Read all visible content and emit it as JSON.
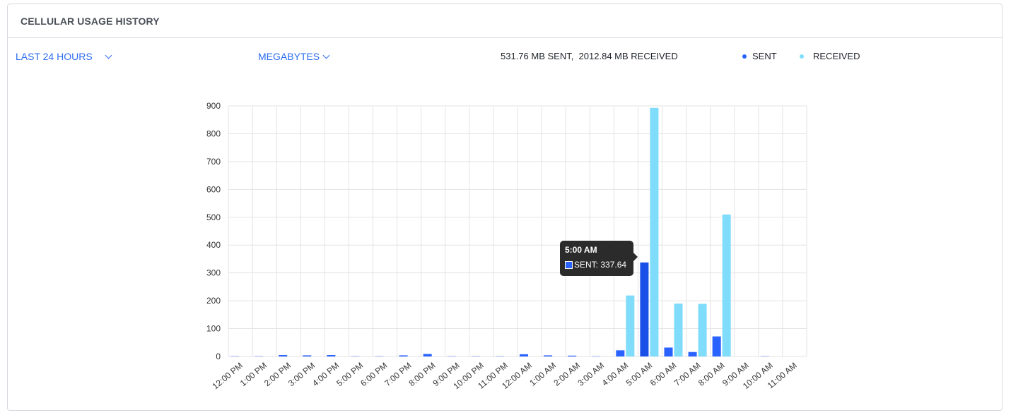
{
  "card": {
    "title": "CELLULAR USAGE HISTORY"
  },
  "controls": {
    "range_label": "LAST 24 HOURS",
    "unit_label": "MEGABYTES",
    "totals_text": "531.76 MB SENT,  2012.84 MB RECEIVED"
  },
  "colors": {
    "sent": "#2962ff",
    "received": "#80dcfb",
    "accent": "#2c6cf0"
  },
  "chart_data": {
    "type": "bar",
    "categories": [
      "12:00 PM",
      "1:00 PM",
      "2:00 PM",
      "3:00 PM",
      "4:00 PM",
      "5:00 PM",
      "6:00 PM",
      "7:00 PM",
      "8:00 PM",
      "9:00 PM",
      "10:00 PM",
      "11:00 PM",
      "12:00 AM",
      "1:00 AM",
      "2:00 AM",
      "3:00 AM",
      "4:00 AM",
      "5:00 AM",
      "6:00 AM",
      "7:00 AM",
      "8:00 AM",
      "9:00 AM",
      "10:00 AM",
      "11:00 AM"
    ],
    "series": [
      {
        "name": "SENT",
        "values": [
          1,
          1,
          5,
          4,
          5,
          1,
          1,
          4,
          9,
          1,
          1,
          1,
          8,
          4,
          3,
          1,
          22,
          337.64,
          32,
          16,
          72,
          0,
          1,
          0
        ]
      },
      {
        "name": "RECEIVED",
        "values": [
          0,
          0,
          0,
          0,
          0,
          0,
          0,
          0,
          0,
          0,
          0,
          0,
          0,
          0,
          0,
          0,
          219,
          893,
          190,
          189,
          510,
          0,
          0,
          0
        ]
      }
    ],
    "yticks": [
      0,
      100,
      200,
      300,
      400,
      500,
      600,
      700,
      800,
      900
    ],
    "ylim": [
      0,
      900
    ],
    "grid": true,
    "legend": "top-right",
    "tooltip": {
      "title": "5:00 AM",
      "text": "SENT: 337.64"
    }
  }
}
